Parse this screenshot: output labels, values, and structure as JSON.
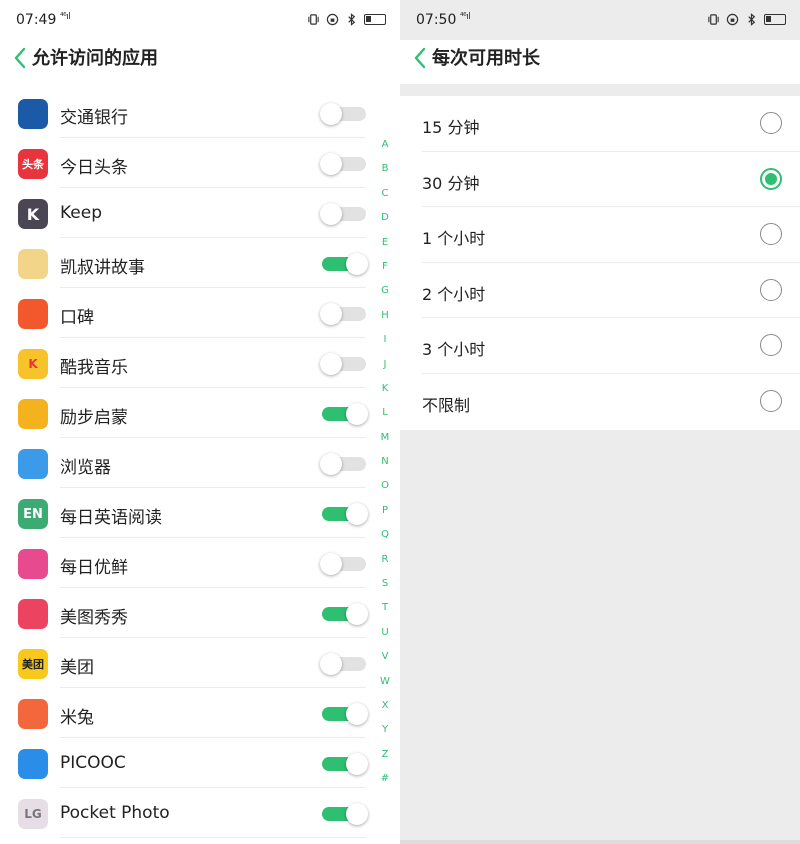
{
  "left": {
    "status": {
      "time": "07:49",
      "network": "⁴⁶ıl"
    },
    "title": "允许访问的应用",
    "apps": [
      {
        "name": "交通银行",
        "on": false,
        "icon": "bocom-icon",
        "color": "#1b5aa6",
        "glyph": ""
      },
      {
        "name": "今日头条",
        "on": false,
        "icon": "toutiao-icon",
        "color": "#e8343c",
        "glyph": "头条"
      },
      {
        "name": "Keep",
        "on": false,
        "icon": "keep-icon",
        "color": "#4a4654",
        "glyph": "K"
      },
      {
        "name": "凯叔讲故事",
        "on": true,
        "icon": "kaishu-icon",
        "color": "#f3d58a",
        "glyph": ""
      },
      {
        "name": "口碑",
        "on": false,
        "icon": "koubei-icon",
        "color": "#f3582d",
        "glyph": ""
      },
      {
        "name": "酷我音乐",
        "on": false,
        "icon": "kuwo-icon",
        "color": "#f8c32a",
        "glyph": "K"
      },
      {
        "name": "励步启蒙",
        "on": true,
        "icon": "libu-icon",
        "color": "#f4b21f",
        "glyph": ""
      },
      {
        "name": "浏览器",
        "on": false,
        "icon": "browser-icon",
        "color": "#3b9be8",
        "glyph": ""
      },
      {
        "name": "每日英语阅读",
        "on": true,
        "icon": "english-reading-icon",
        "color": "#3cab73",
        "glyph": "EN"
      },
      {
        "name": "每日优鲜",
        "on": false,
        "icon": "missfresh-icon",
        "color": "#e84a8f",
        "glyph": ""
      },
      {
        "name": "美图秀秀",
        "on": true,
        "icon": "meitu-icon",
        "color": "#ec4360",
        "glyph": ""
      },
      {
        "name": "美团",
        "on": false,
        "icon": "meituan-icon",
        "color": "#f8c81c",
        "glyph": "美团"
      },
      {
        "name": "米兔",
        "on": true,
        "icon": "mitu-icon",
        "color": "#f2673c",
        "glyph": ""
      },
      {
        "name": "PICOOC",
        "on": true,
        "icon": "picooc-icon",
        "color": "#2a8ee8",
        "glyph": ""
      },
      {
        "name": "Pocket Photo",
        "on": true,
        "icon": "pocket-photo-icon",
        "color": "#e7dde6",
        "glyph": "LG"
      }
    ],
    "index_letters": [
      "A",
      "B",
      "C",
      "D",
      "E",
      "F",
      "G",
      "H",
      "I",
      "J",
      "K",
      "L",
      "M",
      "N",
      "O",
      "P",
      "Q",
      "R",
      "S",
      "T",
      "U",
      "V",
      "W",
      "X",
      "Y",
      "Z",
      "#"
    ]
  },
  "right": {
    "status": {
      "time": "07:50",
      "network": "⁴⁶ıl"
    },
    "title": "每次可用时长",
    "options": [
      {
        "label": "15 分钟",
        "selected": false
      },
      {
        "label": "30 分钟",
        "selected": true
      },
      {
        "label": "1 个小时",
        "selected": false
      },
      {
        "label": "2 个小时",
        "selected": false
      },
      {
        "label": "3 个小时",
        "selected": false
      },
      {
        "label": "不限制",
        "selected": false
      }
    ]
  },
  "colors": {
    "accent": "#2fbf71",
    "toggle_off": "#e2e2e2",
    "divider": "#ececec"
  }
}
